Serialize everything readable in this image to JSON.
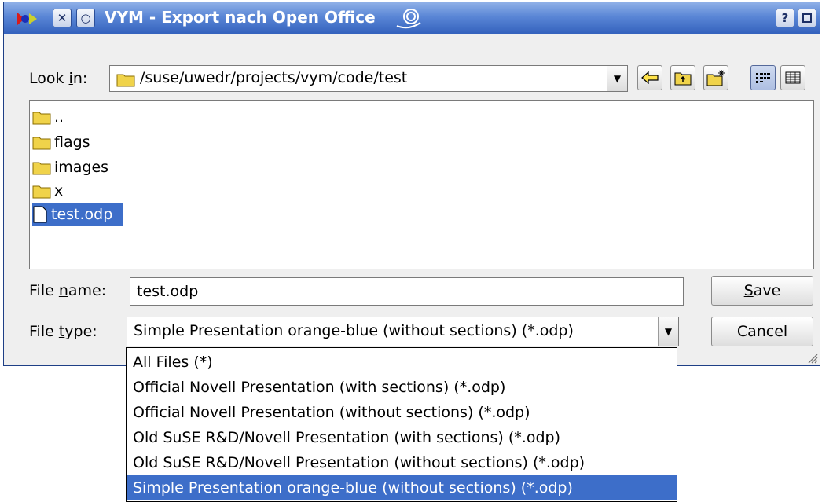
{
  "window": {
    "title": "VYM - Export nach Open Office",
    "help_label": "?"
  },
  "look_in": {
    "label_pre": "Look ",
    "label_underline": "i",
    "label_post": "n:",
    "path": "/suse/uwedr/projects/vym/code/test"
  },
  "files": [
    {
      "name": "..",
      "type": "folder",
      "selected": false
    },
    {
      "name": "flags",
      "type": "folder",
      "selected": false
    },
    {
      "name": "images",
      "type": "folder",
      "selected": false
    },
    {
      "name": "x",
      "type": "folder",
      "selected": false
    },
    {
      "name": "test.odp",
      "type": "file",
      "selected": true
    }
  ],
  "file_name": {
    "label_pre": "File ",
    "label_underline": "n",
    "label_post": "ame:",
    "value": "test.odp"
  },
  "file_type": {
    "label_pre": "File ",
    "label_underline": "t",
    "label_post": "ype:",
    "value": "Simple Presentation orange-blue (without sections) (*.odp)"
  },
  "buttons": {
    "save_underline": "S",
    "save_rest": "ave",
    "cancel": "Cancel"
  },
  "dropdown_options": [
    "All Files (*)",
    "Official Novell Presentation (with sections) (*.odp)",
    "Official Novell Presentation (without sections) (*.odp)",
    "Old SuSE R&D/Novell Presentation (with sections) (*.odp)",
    "Old SuSE R&D/Novell Presentation (without sections) (*.odp)",
    "Simple Presentation orange-blue (without sections) (*.odp)"
  ],
  "selected_option_index": 5,
  "colors": {
    "titlebar": "#3462bd",
    "selection": "#3d6ec9"
  },
  "icons": {
    "back": "back-arrow-icon",
    "parent": "parent-folder-icon",
    "new_folder": "new-folder-icon",
    "list_view": "list-view-icon",
    "detail_view": "detail-view-icon"
  }
}
